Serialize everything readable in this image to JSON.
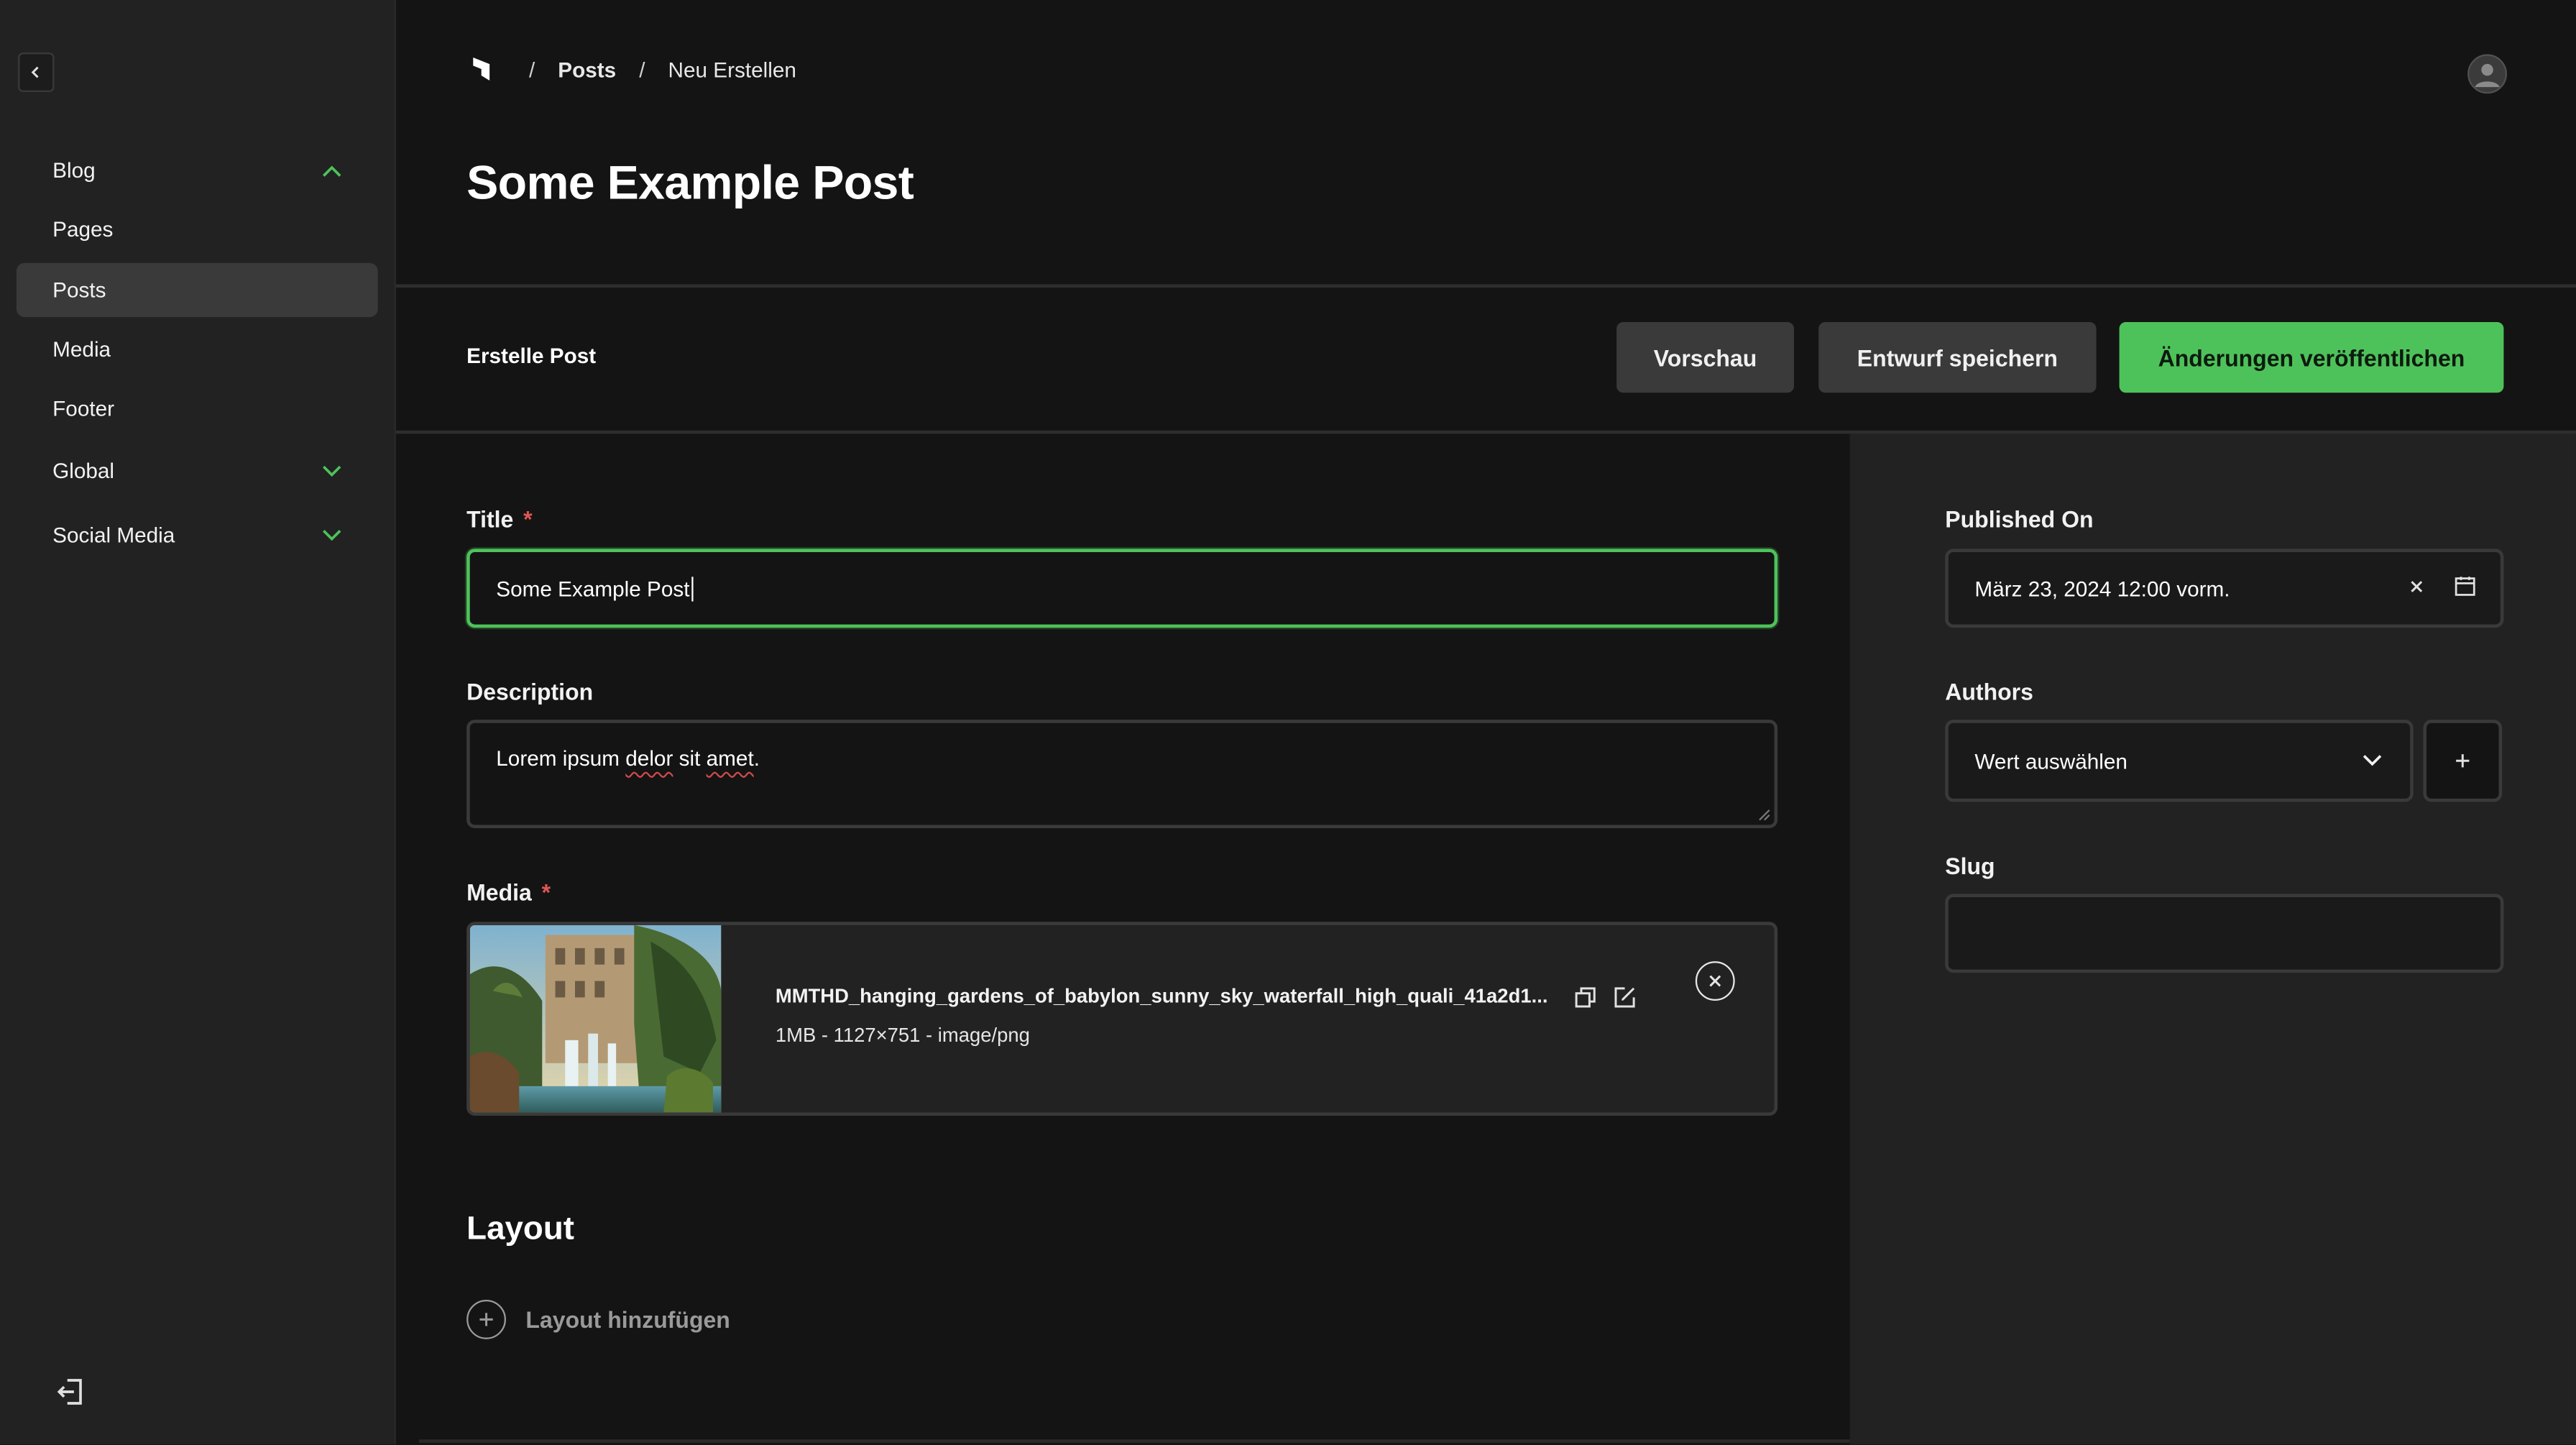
{
  "sidebar": {
    "items": [
      {
        "label": "Blog",
        "expanded": true
      },
      {
        "label": "Pages"
      },
      {
        "label": "Posts",
        "active": true
      },
      {
        "label": "Media"
      },
      {
        "label": "Footer"
      },
      {
        "label": "Global",
        "expanded": false
      },
      {
        "label": "Social Media",
        "expanded": false
      }
    ]
  },
  "header": {
    "breadcrumb": [
      "Posts",
      "Neu Erstellen"
    ],
    "title": "Some Example Post"
  },
  "toolbar": {
    "label": "Erstelle Post",
    "preview_label": "Vorschau",
    "save_draft_label": "Entwurf speichern",
    "publish_label": "Änderungen veröffentlichen"
  },
  "form": {
    "title": {
      "label": "Title",
      "required_mark": "*",
      "value": "Some Example Post"
    },
    "description": {
      "label": "Description",
      "value_prefix": "Lorem ipsum ",
      "value_misspelled_1": "delor",
      "value_mid": " sit ",
      "value_misspelled_2": "amet",
      "value_suffix": "."
    },
    "media": {
      "label": "Media",
      "required_mark": "*",
      "file_name": "MMTHD_hanging_gardens_of_babylon_sunny_sky_waterfall_high_quali_41a2d1...",
      "file_meta": "1MB - 1127×751 - image/png"
    },
    "layout": {
      "title": "Layout",
      "add_label": "Layout hinzufügen"
    }
  },
  "side": {
    "published_on": {
      "label": "Published On",
      "value": "März 23, 2024 12:00 vorm."
    },
    "authors": {
      "label": "Authors",
      "placeholder": "Wert auswählen"
    },
    "slug": {
      "label": "Slug",
      "value": ""
    }
  },
  "colors": {
    "accent": "#4ec25a",
    "required": "#e05555",
    "background": "#141414",
    "panel": "#222222"
  }
}
